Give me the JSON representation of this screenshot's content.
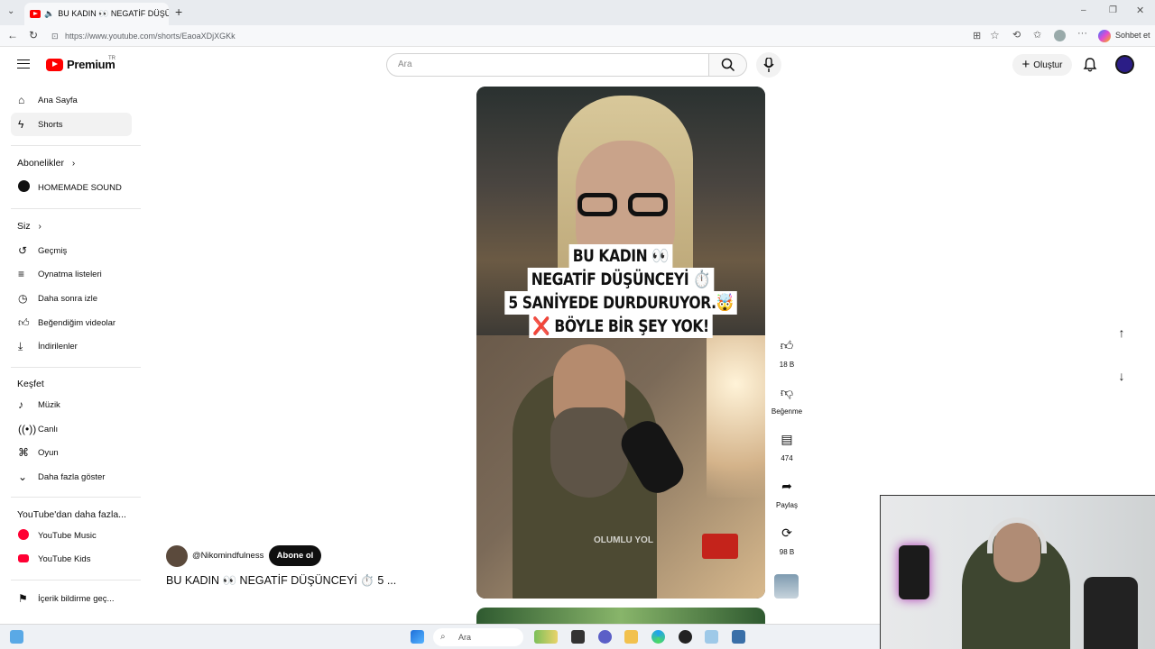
{
  "browser": {
    "tab_title": "BU KADIN 👀 NEGATİF DÜŞÜN",
    "url": "https://www.youtube.com/shorts/EaoaXDjXGKk",
    "chat_label": "Sohbet et"
  },
  "header": {
    "logo": "Premium",
    "region": "TR",
    "search_placeholder": "Ara",
    "create_label": "Oluştur"
  },
  "sidebar": {
    "home": "Ana Sayfa",
    "shorts": "Shorts",
    "subscriptions_title": "Abonelikler",
    "subscription_channel": "HOMEMADE SOUND",
    "you_title": "Siz",
    "you_items": [
      "Geçmiş",
      "Oynatma listeleri",
      "Daha sonra izle",
      "Beğendiğim videolar",
      "İndirilenler"
    ],
    "explore_title": "Keşfet",
    "explore_items": [
      "Müzik",
      "Canlı",
      "Oyun",
      "Daha fazla göster"
    ],
    "more_title": "YouTube'dan daha fazla...",
    "more_items": [
      "YouTube Music",
      "YouTube Kids"
    ],
    "report_history": "İçerik bildirme geç..."
  },
  "video": {
    "overlay_lines": [
      "BU KADIN 👀",
      "NEGATİF DÜŞÜNCEYİ ⏱️",
      "5 SANİYEDE DURDURUYOR.🤯",
      "❌ BÖYLE BİR ŞEY YOK!"
    ],
    "watermark": "OLUMLU YOL",
    "channel": "@Nikomindfulness",
    "subscribe": "Abone ol",
    "title": "BU KADIN 👀 NEGATİF DÜŞÜNCEYİ ⏱️ 5 ..."
  },
  "actions": {
    "likes": "18 B",
    "dislike": "Beğenme",
    "comments": "474",
    "share": "Paylaş",
    "remix": "98 B"
  },
  "taskbar": {
    "search": "Ara"
  }
}
